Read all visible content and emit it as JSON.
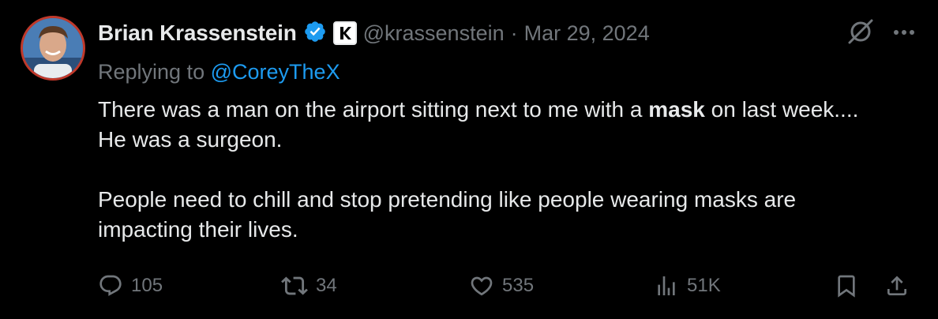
{
  "author": {
    "name": "Brian Krassenstein",
    "handle": "@krassenstein",
    "separator": "·",
    "date": "Mar 29, 2024"
  },
  "reply": {
    "prefix": "Replying to",
    "mention": "@CoreyTheX"
  },
  "tweet": {
    "line1_before": "There was a man on the airport sitting next to me with a ",
    "line1_bold": "mask",
    "line1_after": " on last week.... He was a surgeon.",
    "paragraph2": "People need to chill and stop pretending like people wearing masks are impacting their lives."
  },
  "stats": {
    "replies": "105",
    "reposts": "34",
    "likes": "535",
    "views": "51K"
  },
  "colors": {
    "background": "#000000",
    "text": "#e7e9ea",
    "muted": "#71767b",
    "accent": "#1d9bf0"
  },
  "icons": [
    "verified-badge-icon",
    "k-badge-icon",
    "grok-icon",
    "more-icon",
    "reply-icon",
    "repost-icon",
    "like-icon",
    "views-icon",
    "bookmark-icon",
    "share-icon"
  ]
}
